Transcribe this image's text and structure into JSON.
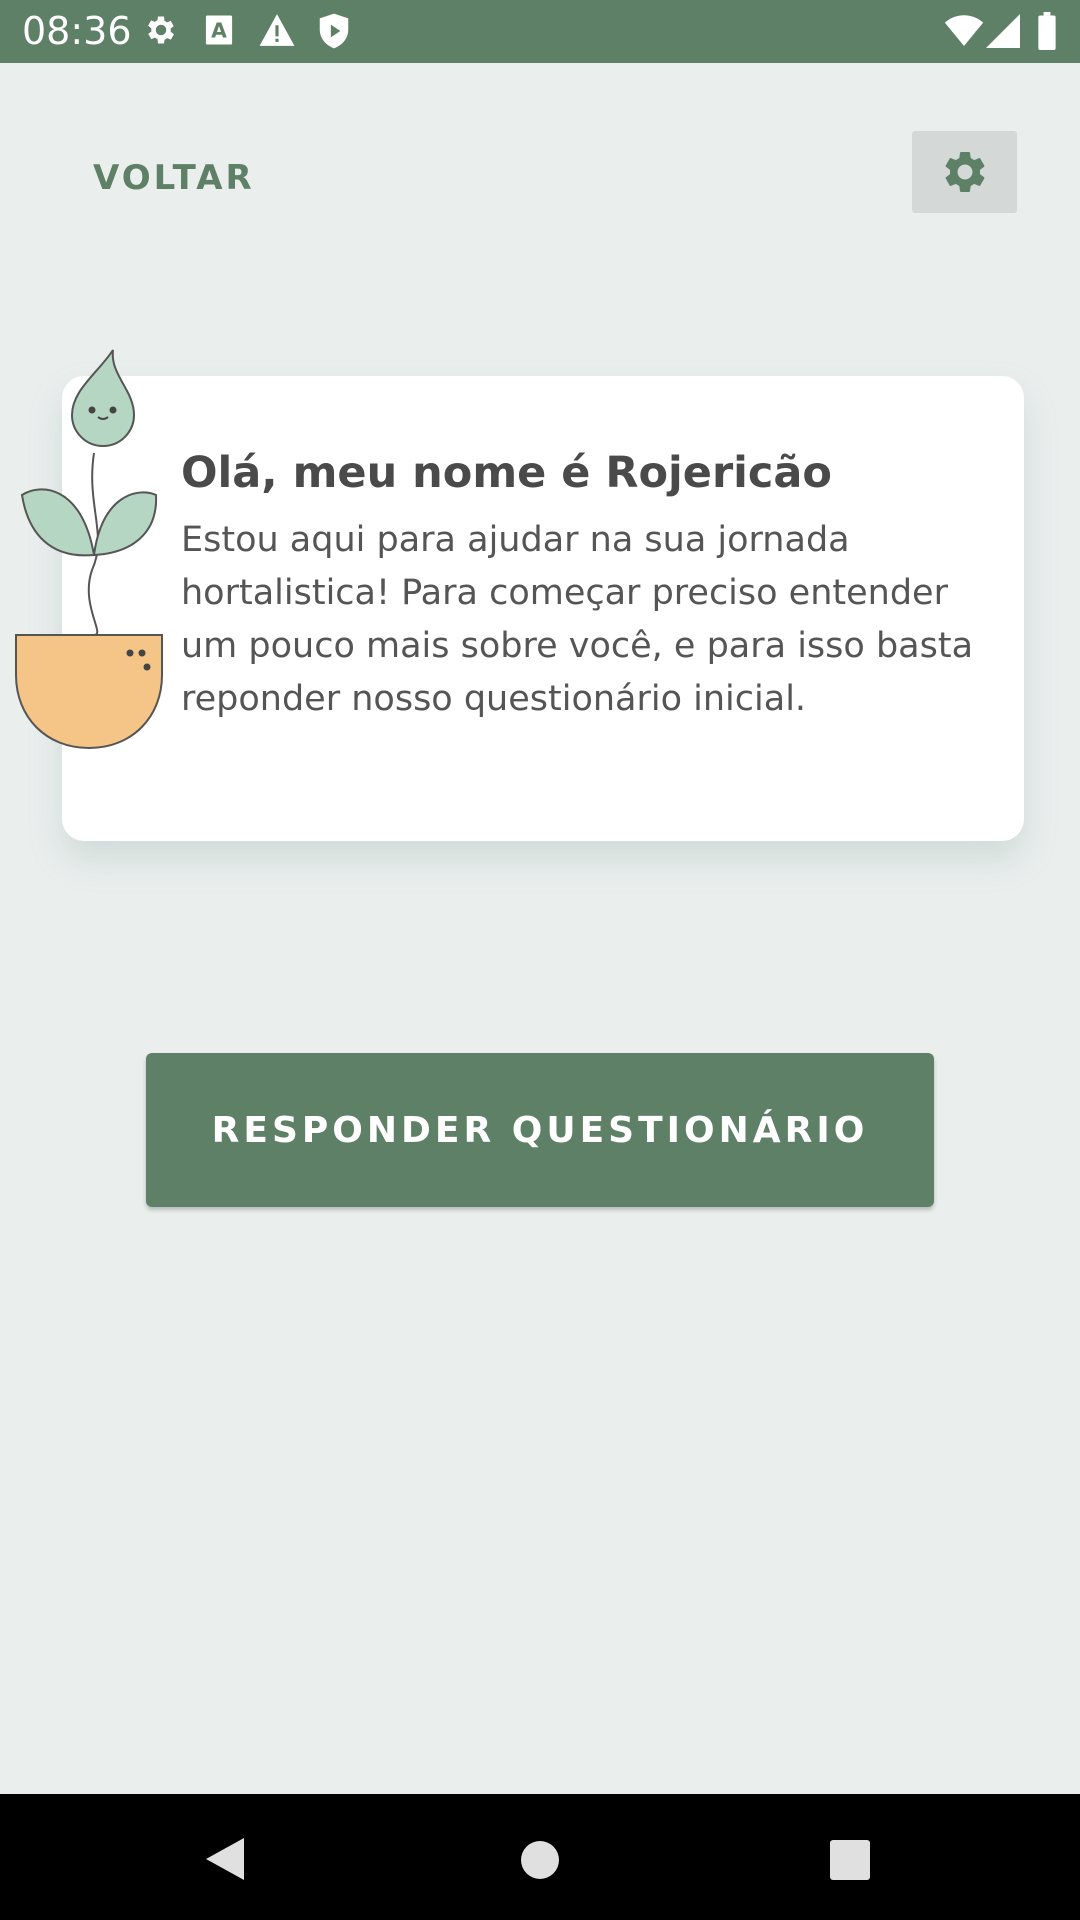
{
  "status_bar": {
    "time": "08:36",
    "left_icons": [
      "settings-icon",
      "text-icon",
      "warning-icon",
      "shield-icon"
    ],
    "right_icons": [
      "wifi-icon",
      "signal-icon",
      "battery-icon"
    ],
    "background": "#5e8066"
  },
  "header": {
    "back_label": "VOLTAR",
    "settings_icon": "gear-icon"
  },
  "intro_card": {
    "title": "Olá, meu nome é Rojericão",
    "body": "Estou aqui para ajudar na sua jornada hortalistica! Para começar preciso entender um pouco mais sobre você, e para isso basta reponder nosso questionário inicial.",
    "mascot": "plant-mascot"
  },
  "cta": {
    "label": "RESPONDER QUESTIONÁRIO"
  },
  "nav_bar": {
    "buttons": [
      "back-icon",
      "home-icon",
      "recents-icon"
    ]
  },
  "colors": {
    "primary": "#5e8066",
    "background": "#eaefee",
    "card": "#ffffff",
    "mascot_leaf": "#b5d6c2",
    "mascot_pot": "#f5c587"
  }
}
